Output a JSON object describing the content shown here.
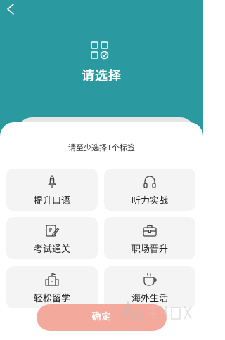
{
  "header": {
    "title": "请选择",
    "back_icon": "arrow-left-icon",
    "logo_icon": "grid-check-icon"
  },
  "panel": {
    "subtitle": "请至少选择1个标签",
    "tags": [
      {
        "label": "提升口语",
        "icon": "rocket-icon"
      },
      {
        "label": "听力实战",
        "icon": "headphones-icon"
      },
      {
        "label": "考试通关",
        "icon": "edit-icon"
      },
      {
        "label": "职场晋升",
        "icon": "briefcase-icon"
      },
      {
        "label": "轻松留学",
        "icon": "school-icon"
      },
      {
        "label": "海外生活",
        "icon": "coffee-icon"
      }
    ]
  },
  "footer": {
    "confirm_label": "确定"
  },
  "colors": {
    "header_bg": "#2a9aa0",
    "confirm_bg": "#f3aa9c",
    "tag_bg": "#f4f4f4"
  }
}
